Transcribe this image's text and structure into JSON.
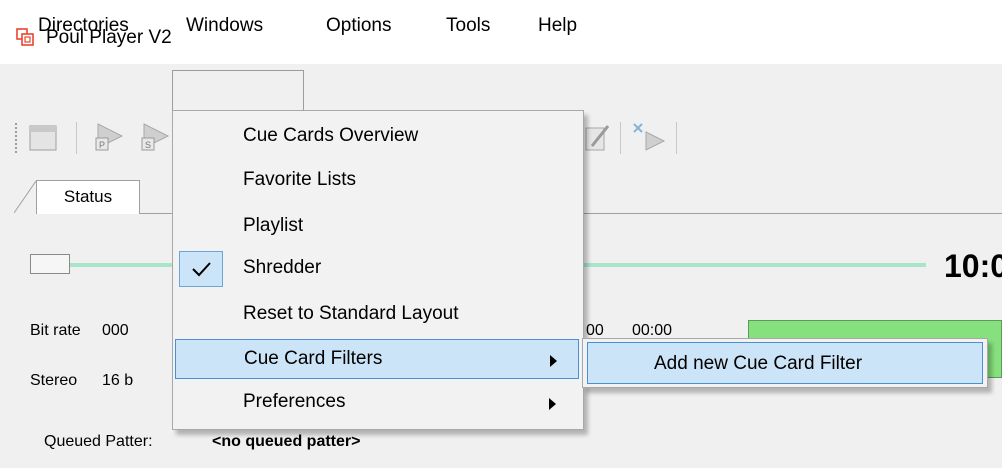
{
  "window": {
    "title": "Poul Player V2"
  },
  "menubar": {
    "items": [
      {
        "label": "Directories"
      },
      {
        "label": "Windows"
      },
      {
        "label": "Options"
      },
      {
        "label": "Tools"
      },
      {
        "label": "Help"
      }
    ]
  },
  "tabs": {
    "status": "Status"
  },
  "player": {
    "time": "10:0",
    "bitrate_label": "Bit rate",
    "bitrate_value": "000",
    "stereo_label": "Stereo",
    "stereo_value": "16 b",
    "time_a": "00",
    "time_b": "00:00",
    "queued_label": "Queued Patter:",
    "queued_value": "<no queued patter>"
  },
  "windows_menu": {
    "items": [
      {
        "label": "Cue Cards Overview"
      },
      {
        "label": "Favorite Lists"
      },
      {
        "label": "Playlist"
      },
      {
        "label": "Shredder",
        "checked": true
      },
      {
        "label": "Reset to Standard Layout"
      },
      {
        "label": "Cue Card Filters",
        "submenu": true,
        "highlighted": true
      },
      {
        "label": "Preferences",
        "submenu": true
      }
    ]
  },
  "cue_card_filters_submenu": {
    "items": [
      {
        "label": "Add new Cue Card Filter"
      }
    ]
  },
  "colors": {
    "menu_highlight": "#cce4f7",
    "highlight_border": "#4c90d4",
    "track": "#a8e6cc",
    "status_green": "#86e07e",
    "app_icon": "#e8462f"
  },
  "icons": [
    "app-icon",
    "checkmark-icon",
    "submenu-arrow-icon",
    "toolbar-icons"
  ]
}
